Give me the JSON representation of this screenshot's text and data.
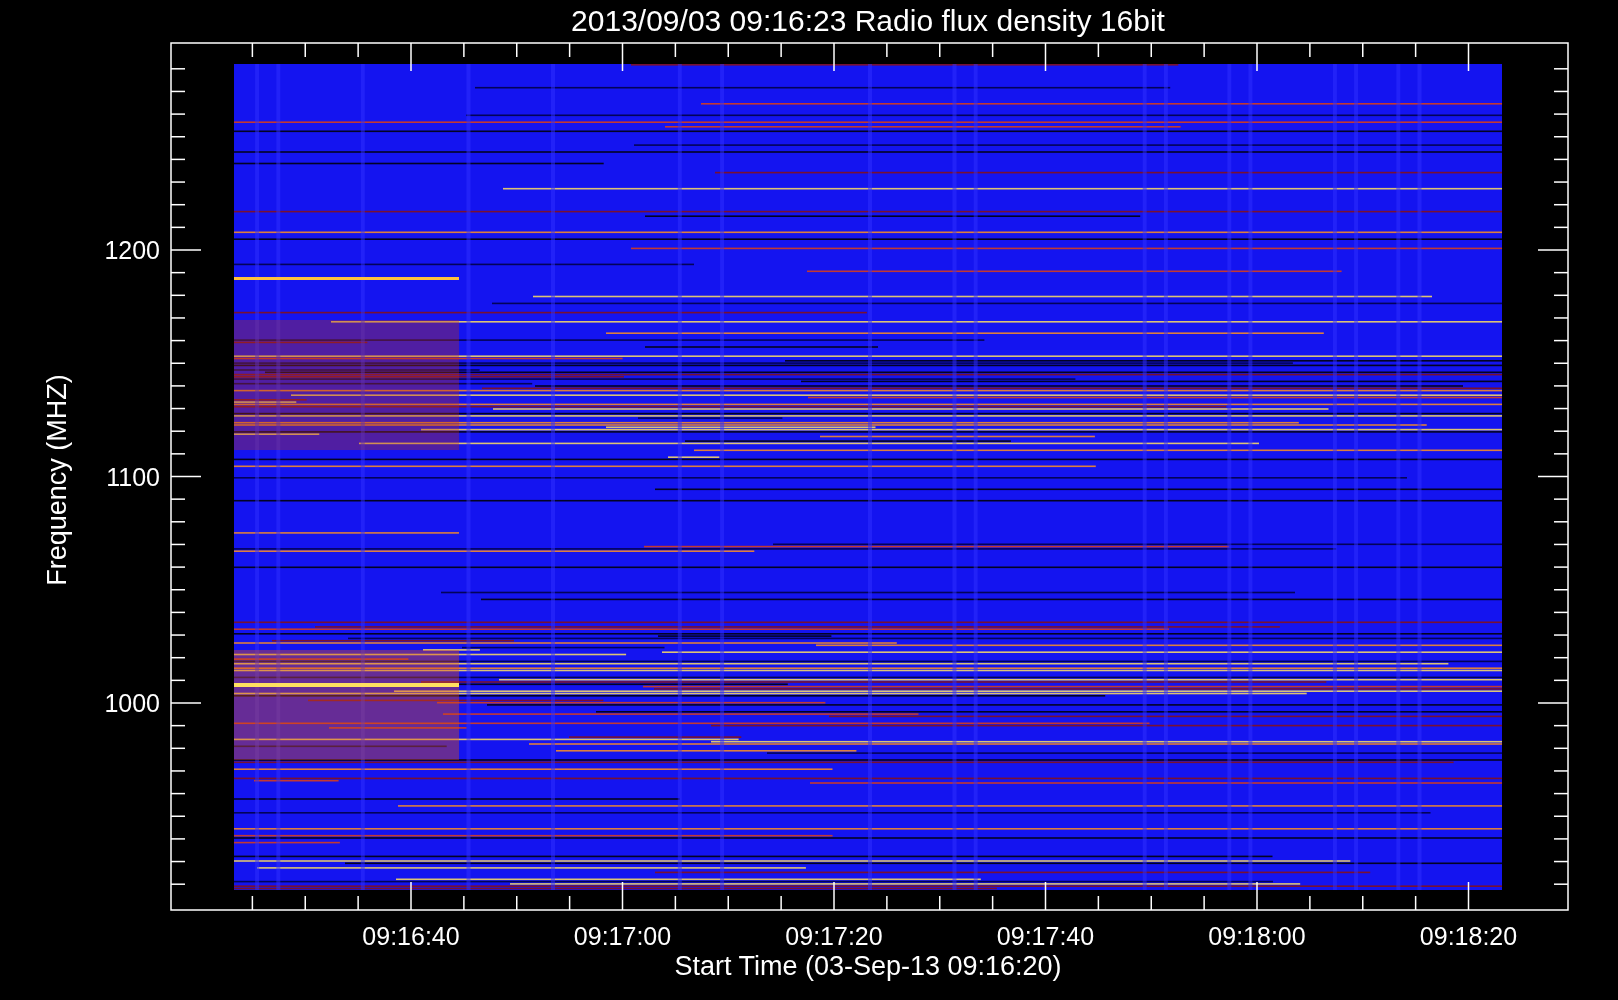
{
  "title": "2013/09/03 09:16:23 Radio flux density 16bit",
  "plot": {
    "ylabel": "Frequency (MHZ)",
    "xlabel": "Start Time (03-Sep-13 09:16:20)",
    "yticks": [
      "1200",
      "1100",
      "1000"
    ],
    "xticks": [
      "09:16:40",
      "09:17:00",
      "09:17:20",
      "09:17:40",
      "09:18:00",
      "09:18:20"
    ]
  }
}
